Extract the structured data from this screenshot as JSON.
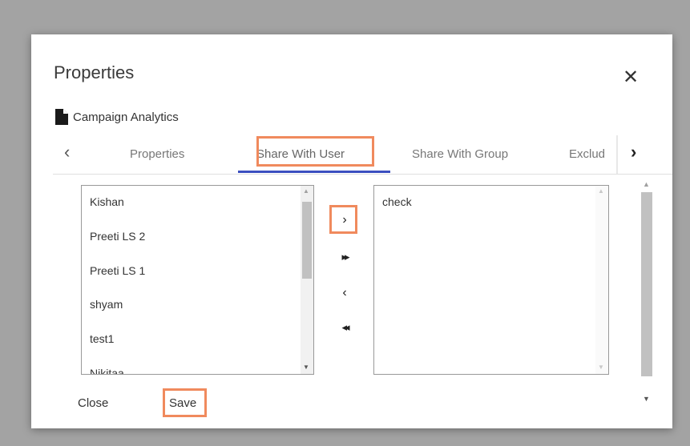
{
  "dialog": {
    "title": "Properties",
    "close_icon": "close-icon",
    "document_name": "Campaign Analytics",
    "document_icon": "file-icon"
  },
  "tabs": [
    {
      "label": "Properties",
      "active": false
    },
    {
      "label": "Share With User",
      "active": true
    },
    {
      "label": "Share With Group",
      "active": false
    },
    {
      "label": "Exclud",
      "active": false
    }
  ],
  "available_users": [
    "Kishan",
    "Preeti LS 2",
    "Preeti LS 1",
    "shyam",
    "test1",
    "Nikitaa"
  ],
  "selected_users": [
    "check"
  ],
  "transfer_controls": {
    "move_right": "›",
    "move_all_right": "▸▸",
    "move_left": "‹",
    "move_all_left": "◂◂"
  },
  "footer": {
    "close_label": "Close",
    "save_label": "Save"
  },
  "colors": {
    "accent": "#3b4fbf",
    "highlight": "#f08a5d",
    "backdrop": "#a3a3a3"
  }
}
